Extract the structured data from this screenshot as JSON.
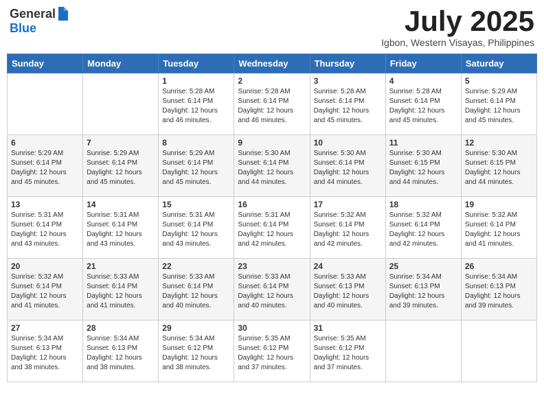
{
  "header": {
    "logo_general": "General",
    "logo_blue": "Blue",
    "month_title": "July 2025",
    "location": "Igbon, Western Visayas, Philippines"
  },
  "weekdays": [
    "Sunday",
    "Monday",
    "Tuesday",
    "Wednesday",
    "Thursday",
    "Friday",
    "Saturday"
  ],
  "weeks": [
    [
      {
        "day": "",
        "info": ""
      },
      {
        "day": "",
        "info": ""
      },
      {
        "day": "1",
        "info": "Sunrise: 5:28 AM\nSunset: 6:14 PM\nDaylight: 12 hours and 46 minutes."
      },
      {
        "day": "2",
        "info": "Sunrise: 5:28 AM\nSunset: 6:14 PM\nDaylight: 12 hours and 46 minutes."
      },
      {
        "day": "3",
        "info": "Sunrise: 5:28 AM\nSunset: 6:14 PM\nDaylight: 12 hours and 45 minutes."
      },
      {
        "day": "4",
        "info": "Sunrise: 5:28 AM\nSunset: 6:14 PM\nDaylight: 12 hours and 45 minutes."
      },
      {
        "day": "5",
        "info": "Sunrise: 5:29 AM\nSunset: 6:14 PM\nDaylight: 12 hours and 45 minutes."
      }
    ],
    [
      {
        "day": "6",
        "info": "Sunrise: 5:29 AM\nSunset: 6:14 PM\nDaylight: 12 hours and 45 minutes."
      },
      {
        "day": "7",
        "info": "Sunrise: 5:29 AM\nSunset: 6:14 PM\nDaylight: 12 hours and 45 minutes."
      },
      {
        "day": "8",
        "info": "Sunrise: 5:29 AM\nSunset: 6:14 PM\nDaylight: 12 hours and 45 minutes."
      },
      {
        "day": "9",
        "info": "Sunrise: 5:30 AM\nSunset: 6:14 PM\nDaylight: 12 hours and 44 minutes."
      },
      {
        "day": "10",
        "info": "Sunrise: 5:30 AM\nSunset: 6:14 PM\nDaylight: 12 hours and 44 minutes."
      },
      {
        "day": "11",
        "info": "Sunrise: 5:30 AM\nSunset: 6:15 PM\nDaylight: 12 hours and 44 minutes."
      },
      {
        "day": "12",
        "info": "Sunrise: 5:30 AM\nSunset: 6:15 PM\nDaylight: 12 hours and 44 minutes."
      }
    ],
    [
      {
        "day": "13",
        "info": "Sunrise: 5:31 AM\nSunset: 6:14 PM\nDaylight: 12 hours and 43 minutes."
      },
      {
        "day": "14",
        "info": "Sunrise: 5:31 AM\nSunset: 6:14 PM\nDaylight: 12 hours and 43 minutes."
      },
      {
        "day": "15",
        "info": "Sunrise: 5:31 AM\nSunset: 6:14 PM\nDaylight: 12 hours and 43 minutes."
      },
      {
        "day": "16",
        "info": "Sunrise: 5:31 AM\nSunset: 6:14 PM\nDaylight: 12 hours and 42 minutes."
      },
      {
        "day": "17",
        "info": "Sunrise: 5:32 AM\nSunset: 6:14 PM\nDaylight: 12 hours and 42 minutes."
      },
      {
        "day": "18",
        "info": "Sunrise: 5:32 AM\nSunset: 6:14 PM\nDaylight: 12 hours and 42 minutes."
      },
      {
        "day": "19",
        "info": "Sunrise: 5:32 AM\nSunset: 6:14 PM\nDaylight: 12 hours and 41 minutes."
      }
    ],
    [
      {
        "day": "20",
        "info": "Sunrise: 5:32 AM\nSunset: 6:14 PM\nDaylight: 12 hours and 41 minutes."
      },
      {
        "day": "21",
        "info": "Sunrise: 5:33 AM\nSunset: 6:14 PM\nDaylight: 12 hours and 41 minutes."
      },
      {
        "day": "22",
        "info": "Sunrise: 5:33 AM\nSunset: 6:14 PM\nDaylight: 12 hours and 40 minutes."
      },
      {
        "day": "23",
        "info": "Sunrise: 5:33 AM\nSunset: 6:14 PM\nDaylight: 12 hours and 40 minutes."
      },
      {
        "day": "24",
        "info": "Sunrise: 5:33 AM\nSunset: 6:13 PM\nDaylight: 12 hours and 40 minutes."
      },
      {
        "day": "25",
        "info": "Sunrise: 5:34 AM\nSunset: 6:13 PM\nDaylight: 12 hours and 39 minutes."
      },
      {
        "day": "26",
        "info": "Sunrise: 5:34 AM\nSunset: 6:13 PM\nDaylight: 12 hours and 39 minutes."
      }
    ],
    [
      {
        "day": "27",
        "info": "Sunrise: 5:34 AM\nSunset: 6:13 PM\nDaylight: 12 hours and 38 minutes."
      },
      {
        "day": "28",
        "info": "Sunrise: 5:34 AM\nSunset: 6:13 PM\nDaylight: 12 hours and 38 minutes."
      },
      {
        "day": "29",
        "info": "Sunrise: 5:34 AM\nSunset: 6:12 PM\nDaylight: 12 hours and 38 minutes."
      },
      {
        "day": "30",
        "info": "Sunrise: 5:35 AM\nSunset: 6:12 PM\nDaylight: 12 hours and 37 minutes."
      },
      {
        "day": "31",
        "info": "Sunrise: 5:35 AM\nSunset: 6:12 PM\nDaylight: 12 hours and 37 minutes."
      },
      {
        "day": "",
        "info": ""
      },
      {
        "day": "",
        "info": ""
      }
    ]
  ]
}
